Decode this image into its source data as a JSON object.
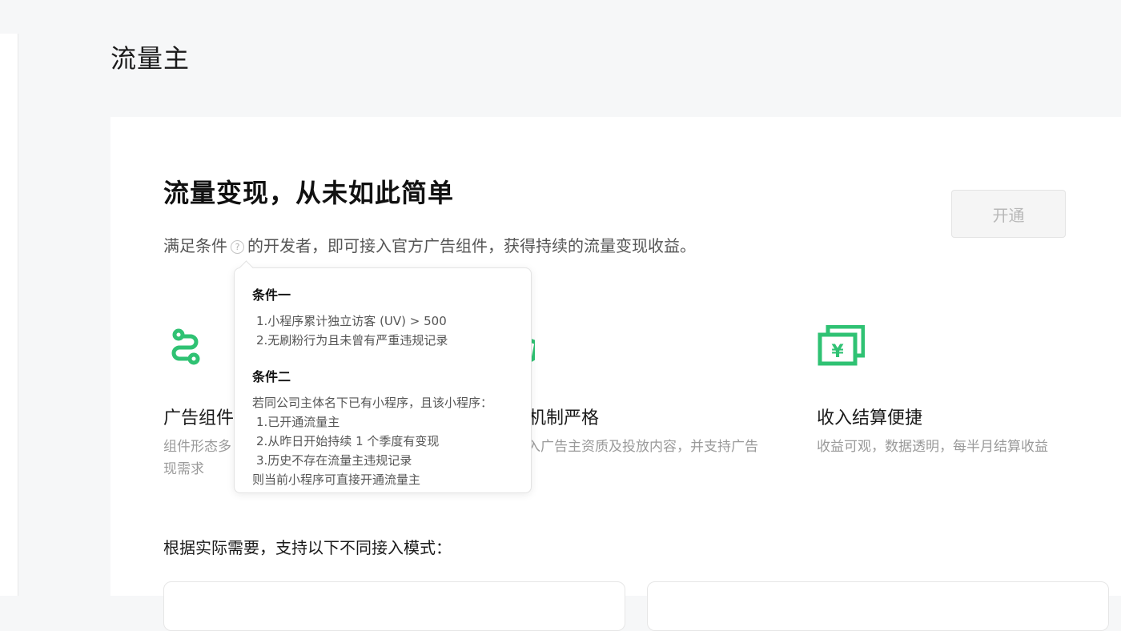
{
  "page": {
    "title": "流量主"
  },
  "hero": {
    "title": "流量变现，从未如此简单",
    "subtitle_before": "满足条件",
    "help_glyph": "?",
    "subtitle_after": "的开发者，即可接入官方广告组件，获得持续的流量变现收益。",
    "open_button": "开通"
  },
  "features": [
    {
      "icon": "route-icon",
      "title": "广告组件丰富",
      "title_visible": "广告组件",
      "desc_visible": [
        "组件形态多",
        "现需求"
      ]
    },
    {
      "icon": "shield-check-icon",
      "title_visible": "机制严格",
      "desc_visible": "入广告主资质及投放内容，并支持广告"
    },
    {
      "icon": "yen-bill-icon",
      "title": "收入结算便捷",
      "desc": "收益可观，数据透明，每半月结算收益"
    }
  ],
  "modes": {
    "heading": "根据实际需要，支持以下不同接入模式："
  },
  "tooltip": {
    "cond1_title": "条件一",
    "cond1_items": [
      "1.小程序累计独立访客 (UV) > 500",
      "2.无刷粉行为且未曾有严重违规记录"
    ],
    "cond2_title": "条件二",
    "cond2_intro": "若同公司主体名下已有小程序，且该小程序：",
    "cond2_items": [
      "1.已开通流量主",
      "2.从昨日开始持续 1 个季度有变现",
      "3.历史不存在流量主违规记录"
    ],
    "cond2_outro": "则当前小程序可直接开通流量主"
  },
  "colors": {
    "accent": "#2fc273",
    "disabled_btn_text": "#b8b8b8",
    "page_bg": "#f6f7f8"
  }
}
